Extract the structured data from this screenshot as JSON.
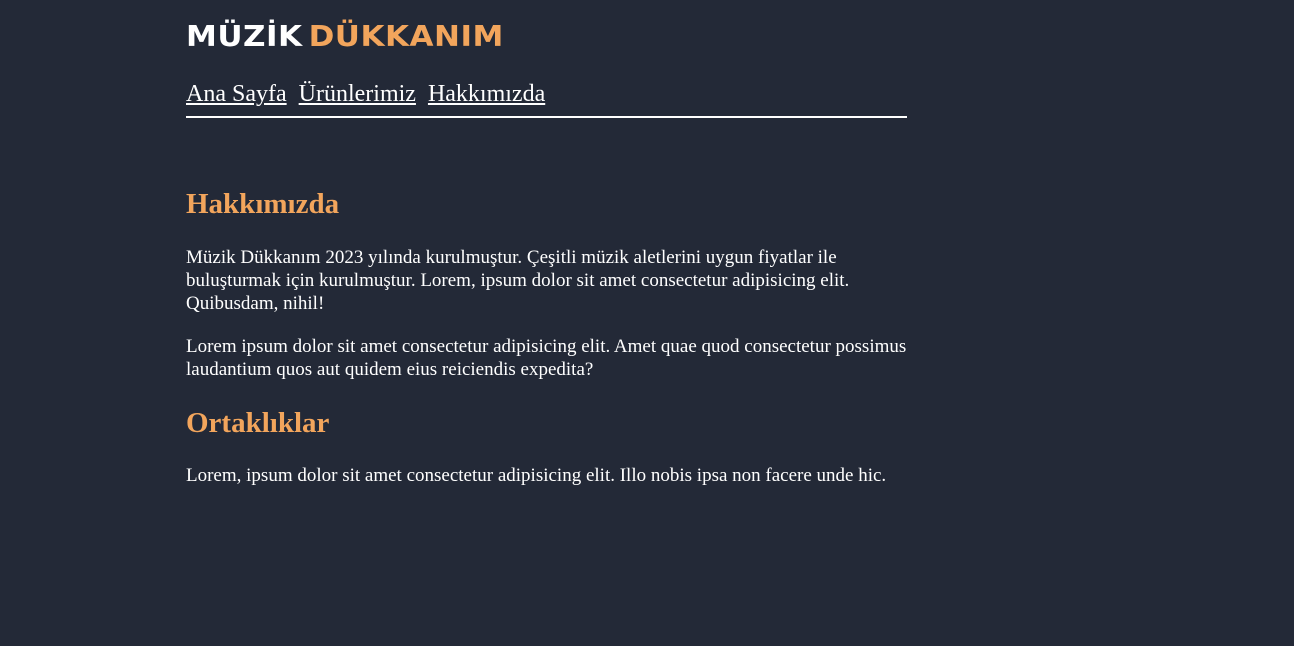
{
  "logo": {
    "word1": "MÜZİK",
    "word2": "DÜKKANIM"
  },
  "nav": {
    "items": [
      {
        "label": "Ana Sayfa"
      },
      {
        "label": "Ürünlerimiz"
      },
      {
        "label": "Hakkımızda"
      }
    ]
  },
  "main": {
    "about": {
      "title": "Hakkımızda",
      "paragraphs": [
        "Müzik Dükkanım 2023 yılında kurulmuştur. Çeşitli müzik aletlerini uygun fiyatlar ile buluşturmak için kurulmuştur. Lorem, ipsum dolor sit amet consectetur adipisicing elit. Quibusdam, nihil!",
        "Lorem ipsum dolor sit amet consectetur adipisicing elit. Amet quae quod consectetur possimus laudantium quos aut quidem eius reiciendis expedita?"
      ]
    },
    "partners": {
      "title": "Ortaklıklar",
      "paragraphs": [
        "Lorem, ipsum dolor sit amet consectetur adipisicing elit. Illo nobis ipsa non facere unde hic."
      ]
    }
  },
  "colors": {
    "background": "#232937",
    "accent": "#f2a55c",
    "text": "#ffffff"
  }
}
